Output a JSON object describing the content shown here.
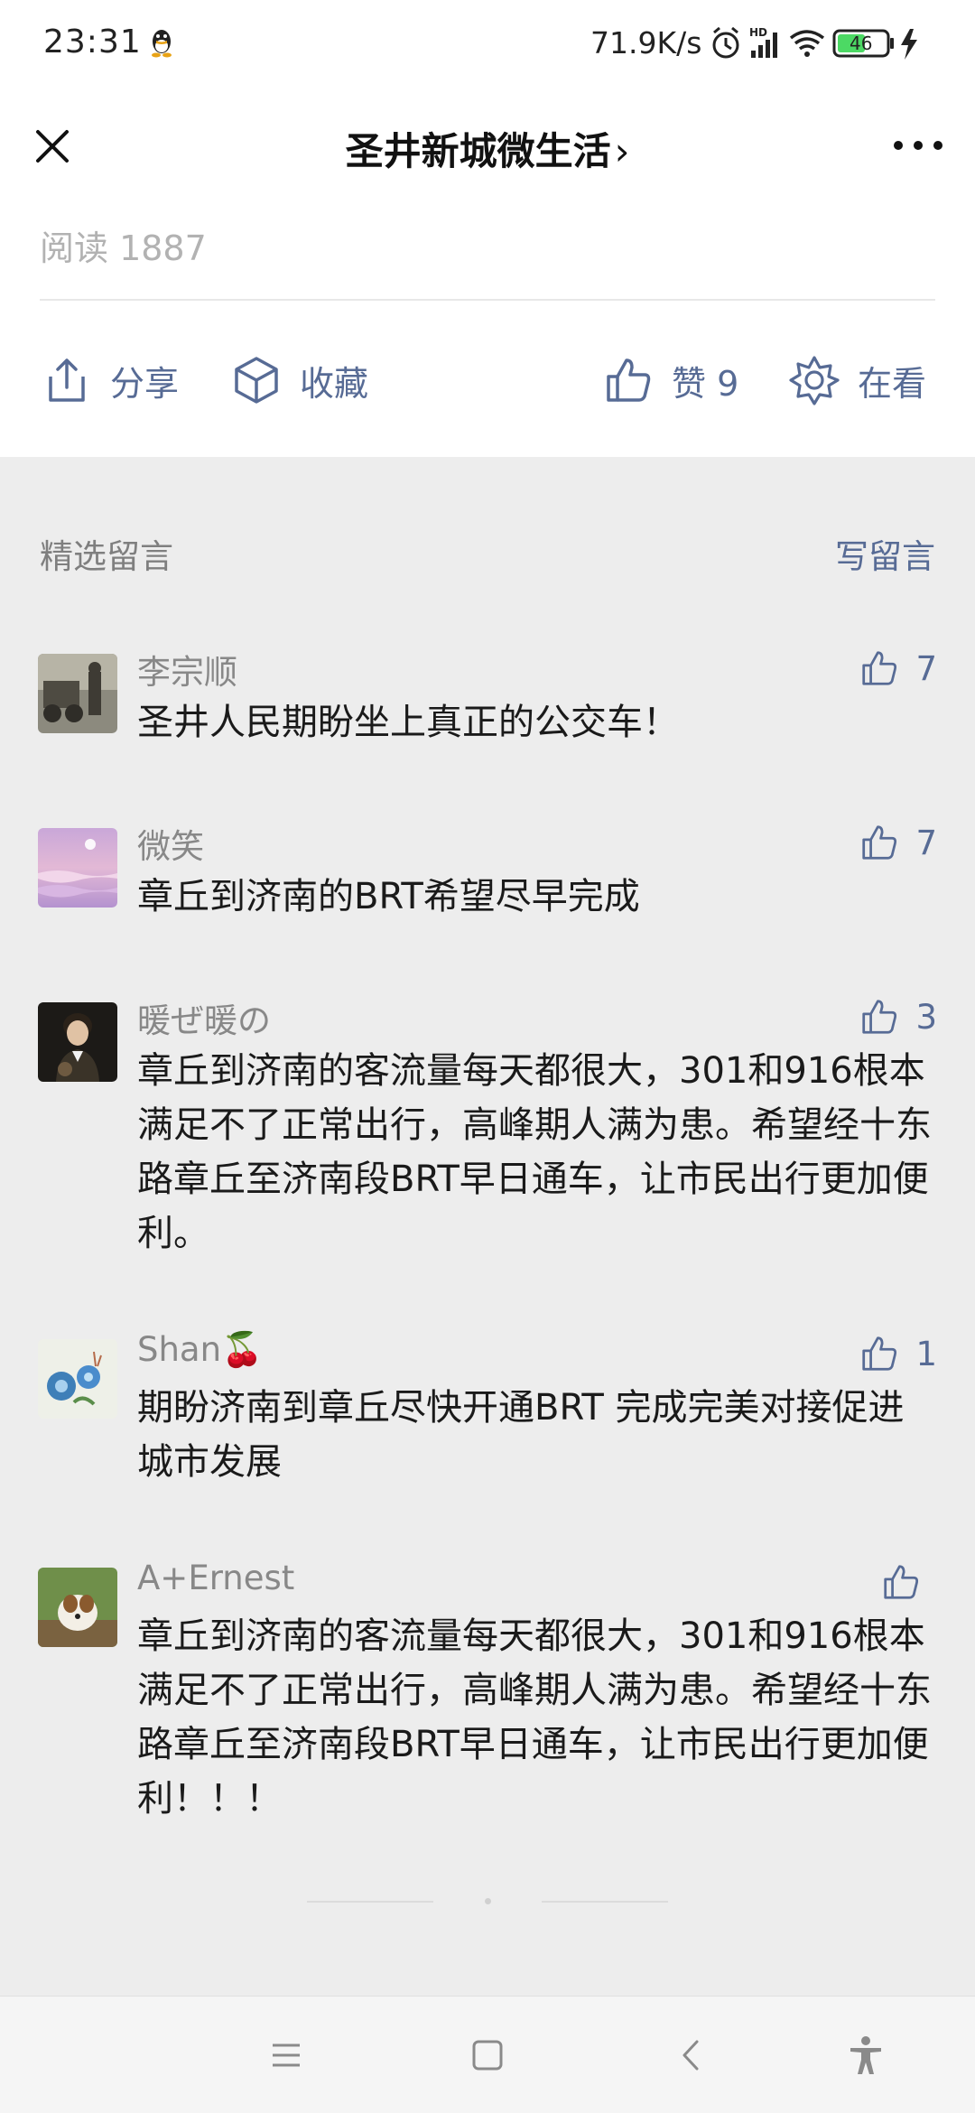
{
  "status_bar": {
    "time": "23:31",
    "network_speed": "71.9K/s",
    "battery": "46",
    "icons": [
      "qq-icon",
      "alarm-icon",
      "hd-signal-icon",
      "wifi-icon",
      "battery-icon",
      "charging-icon"
    ]
  },
  "title_bar": {
    "title": "圣井新城微生活",
    "chevron": "›"
  },
  "article": {
    "read_label": "阅读 1887",
    "actions": {
      "share": "分享",
      "favorite": "收藏",
      "like": "赞 9",
      "wow": "在看"
    }
  },
  "comments": {
    "header": "精选留言",
    "write": "写留言",
    "items": [
      {
        "name": "李宗顺",
        "likes": "7",
        "text": "圣井人民期盼坐上真正的公交车！"
      },
      {
        "name": "微笑",
        "likes": "7",
        "text": "章丘到济南的BRT希望尽早完成"
      },
      {
        "name": "暖ぜ暖の",
        "likes": "3",
        "text": "章丘到济南的客流量每天都很大，301和916根本满足不了正常出行，高峰期人满为患。希望经十东路章丘至济南段BRT早日通车，让市民出行更加便利。"
      },
      {
        "name": "Shan🍒",
        "likes": "1",
        "text": "期盼济南到章丘尽快开通BRT 完成完美对接促进城市发展"
      },
      {
        "name": "A+Ernest",
        "likes": "",
        "text": "章丘到济南的客流量每天都很大，301和916根本满足不了正常出行，高峰期人满为患。希望经十东路章丘至济南段BRT早日通车，让市民出行更加便利！！！"
      }
    ]
  },
  "colors": {
    "link_blue": "#576b95",
    "background": "#ededed",
    "text": "#1a1a1a",
    "muted": "#888888"
  }
}
